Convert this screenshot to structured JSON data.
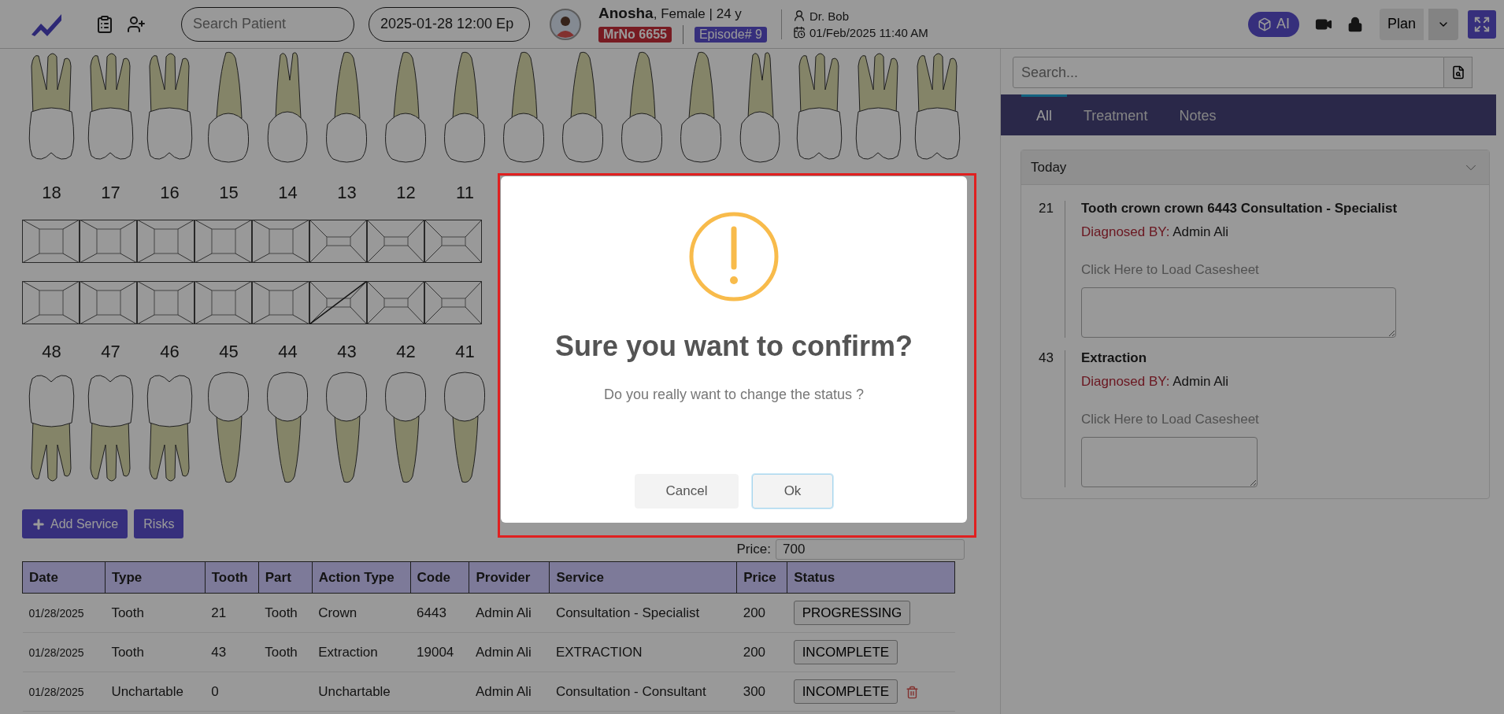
{
  "header": {
    "search": {
      "placeholder": "Search Patient"
    },
    "encounter": {
      "value": "2025-01-28 12:00 Ep"
    },
    "patient": {
      "name": "Anosha",
      "details": ", Female | 24 y",
      "mrno": "MrNo 6655",
      "episode": "Episode# 9"
    },
    "doctor": "Dr. Bob",
    "datetime": "01/Feb/2025 11:40 AM",
    "ai_label": "AI",
    "plan_label": "Plan"
  },
  "chart": {
    "upper_teeth": [
      {
        "kind": "molar"
      },
      {
        "kind": "molar"
      },
      {
        "kind": "molar"
      },
      {
        "kind": "single"
      },
      {
        "kind": "premolar"
      },
      {
        "kind": "single"
      },
      {
        "kind": "single"
      },
      {
        "kind": "single"
      },
      {
        "kind": "single"
      },
      {
        "kind": "single"
      },
      {
        "kind": "single"
      },
      {
        "kind": "single"
      },
      {
        "kind": "premolar"
      },
      {
        "kind": "molar"
      },
      {
        "kind": "molar"
      },
      {
        "kind": "molar"
      }
    ],
    "upper_numbers": [
      "18",
      "17",
      "16",
      "15",
      "14",
      "13",
      "12",
      "11"
    ],
    "surface_rows": [
      [
        {
          "kind": "posterior",
          "struck": false
        },
        {
          "kind": "posterior",
          "struck": false
        },
        {
          "kind": "posterior",
          "struck": false
        },
        {
          "kind": "posterior",
          "struck": false
        },
        {
          "kind": "posterior",
          "struck": false
        },
        {
          "kind": "anterior",
          "struck": false
        },
        {
          "kind": "anterior",
          "struck": false
        },
        {
          "kind": "anterior",
          "struck": false
        }
      ],
      [
        {
          "kind": "posterior",
          "struck": false
        },
        {
          "kind": "posterior",
          "struck": false
        },
        {
          "kind": "posterior",
          "struck": false
        },
        {
          "kind": "posterior",
          "struck": false
        },
        {
          "kind": "posterior",
          "struck": false
        },
        {
          "kind": "anterior",
          "struck": true
        },
        {
          "kind": "anterior",
          "struck": false
        },
        {
          "kind": "anterior",
          "struck": false
        }
      ]
    ],
    "lower_numbers": [
      "48",
      "47",
      "46",
      "45",
      "44",
      "43",
      "42",
      "41"
    ],
    "lower_teeth": [
      {
        "kind": "molar"
      },
      {
        "kind": "molar"
      },
      {
        "kind": "molar"
      },
      {
        "kind": "single"
      },
      {
        "kind": "single"
      },
      {
        "kind": "single"
      },
      {
        "kind": "single"
      },
      {
        "kind": "single"
      }
    ]
  },
  "service_bar": {
    "buttons": [
      {
        "label": "Add Service",
        "kind": "add"
      },
      {
        "label": "Risks",
        "kind": "plain"
      }
    ],
    "price": {
      "label": "Price:",
      "value": "700"
    }
  },
  "table": {
    "columns": [
      "Date",
      "Type",
      "Tooth",
      "Part",
      "Action Type",
      "Code",
      "Provider",
      "Service",
      "Price",
      "Status"
    ],
    "rows": [
      {
        "cells": [
          "01/28/2025",
          "Tooth",
          "21",
          "Tooth",
          "Crown",
          "6443",
          "Admin Ali",
          "Consultation - Specialist",
          "200"
        ],
        "status": "PROGRESSING",
        "deletable": false
      },
      {
        "cells": [
          "01/28/2025",
          "Tooth",
          "43",
          "Tooth",
          "Extraction",
          "19004",
          "Admin Ali",
          "EXTRACTION",
          "200"
        ],
        "status": "INCOMPLETE",
        "deletable": false
      },
      {
        "cells": [
          "01/28/2025",
          "Unchartable",
          "0",
          "",
          "Unchartable",
          "",
          "Admin Ali",
          "Consultation - Consultant",
          "300"
        ],
        "status": "INCOMPLETE",
        "deletable": true
      }
    ]
  },
  "sidebar": {
    "search": {
      "placeholder": "Search..."
    },
    "tabs": [
      {
        "label": "All",
        "selected": true
      },
      {
        "label": "Treatment",
        "selected": false
      },
      {
        "label": "Notes",
        "selected": false
      }
    ],
    "group": {
      "title": "Today",
      "expanded": true,
      "entries": [
        {
          "tooth": "21",
          "title": "Tooth crown crown 6443 Consultation - Specialist",
          "diagnosed_label": "Diagnosed BY:",
          "diagnosed_by": "Admin Ali",
          "link": "Click Here to Load Casesheet",
          "kind": "wide"
        },
        {
          "tooth": "43",
          "title": "Extraction",
          "diagnosed_label": "Diagnosed BY:",
          "diagnosed_by": "Admin Ali",
          "link": "Click Here to Load Casesheet",
          "kind": "narrow"
        }
      ]
    }
  },
  "dialog": {
    "title": "Sure you want to confirm?",
    "message": "Do you really want to change the status ?",
    "buttons": [
      {
        "label": "Cancel",
        "focused": false
      },
      {
        "label": "Ok",
        "focused": true
      }
    ]
  }
}
